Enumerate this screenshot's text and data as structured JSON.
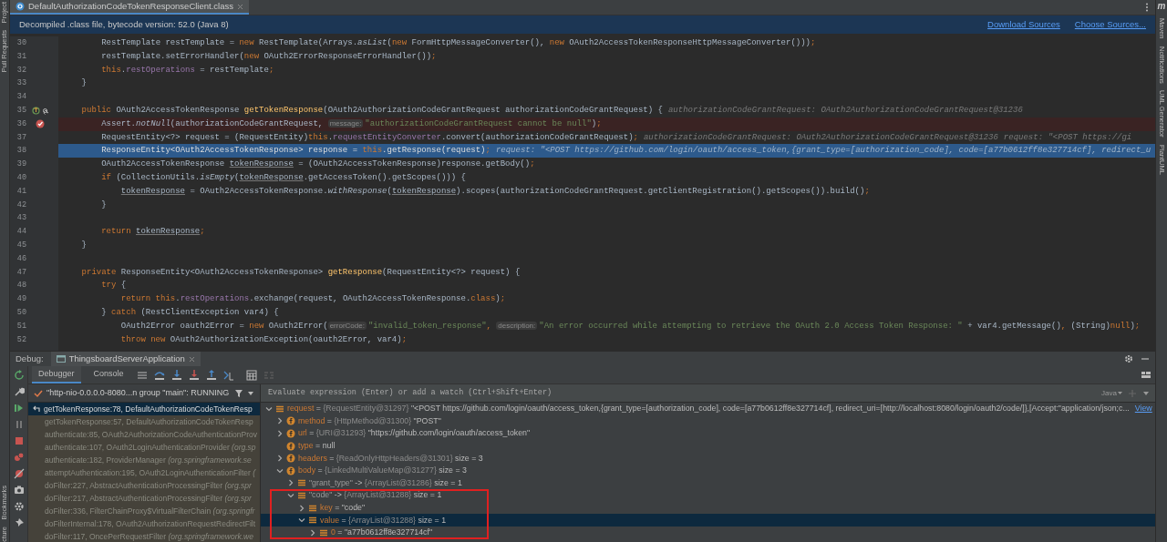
{
  "left_stripe": {
    "labels": [
      "Project",
      "Pull Requests",
      "Bookmarks",
      "cture"
    ]
  },
  "right_stripe": {
    "logo": "m",
    "labels": [
      "Maven",
      "Notifications",
      "UML Generator",
      "PlantUML"
    ]
  },
  "editor_tabs": [
    {
      "label": "DefaultAuthorizationCodeTokenResponseClient.class",
      "selected": true
    }
  ],
  "banner": {
    "text": "Decompiled .class file, bytecode version: 52.0 (Java 8)",
    "links": [
      "Download Sources",
      "Choose Sources..."
    ]
  },
  "code_lines": [
    {
      "number": "30",
      "breakpoint": false,
      "current": false,
      "implements": false,
      "segments": [
        {
          "kind": "p",
          "text": "        RestTemplate restTemplate = "
        },
        {
          "kind": "kw",
          "text": "new "
        },
        {
          "kind": "p",
          "text": "RestTemplate(Arrays."
        },
        {
          "kind": "it",
          "text": "asList"
        },
        {
          "kind": "p",
          "text": "("
        },
        {
          "kind": "kw",
          "text": "new "
        },
        {
          "kind": "p",
          "text": "FormHttpMessageConverter(), "
        },
        {
          "kind": "kw",
          "text": "new "
        },
        {
          "kind": "p",
          "text": "OAuth2AccessTokenResponseHttpMessageConverter()))"
        },
        {
          "kind": "kw",
          "text": ";"
        }
      ]
    },
    {
      "number": "31",
      "breakpoint": false,
      "current": false,
      "implements": false,
      "segments": [
        {
          "kind": "p",
          "text": "        restTemplate.setErrorHandler("
        },
        {
          "kind": "kw",
          "text": "new "
        },
        {
          "kind": "p",
          "text": "OAuth2ErrorResponseErrorHandler())"
        },
        {
          "kind": "kw",
          "text": ";"
        }
      ]
    },
    {
      "number": "32",
      "breakpoint": false,
      "current": false,
      "implements": false,
      "segments": [
        {
          "kind": "kw",
          "text": "        this"
        },
        {
          "kind": "p",
          "text": "."
        },
        {
          "kind": "fld",
          "text": "restOperations"
        },
        {
          "kind": "p",
          "text": " = restTemplate"
        },
        {
          "kind": "kw",
          "text": ";"
        }
      ]
    },
    {
      "number": "33",
      "breakpoint": false,
      "current": false,
      "implements": false,
      "segments": [
        {
          "kind": "p",
          "text": "    }"
        }
      ]
    },
    {
      "number": "34",
      "breakpoint": false,
      "current": false,
      "implements": false
    },
    {
      "number": "35",
      "breakpoint": false,
      "current": false,
      "implements": true,
      "segments": [
        {
          "kind": "kw",
          "text": "    public "
        },
        {
          "kind": "p",
          "text": "OAuth2AccessTokenResponse "
        },
        {
          "kind": "fn",
          "text": "getTokenResponse"
        },
        {
          "kind": "p",
          "text": "(OAuth2AuthorizationCodeGrantRequest authorizationCodeGrantRequest) {"
        },
        {
          "kind": "inlay",
          "text": "authorizationCodeGrantRequest: OAuth2AuthorizationCodeGrantRequest@31236"
        }
      ]
    },
    {
      "number": "36",
      "breakpoint": true,
      "current": false,
      "implements": false,
      "segments": [
        {
          "kind": "p",
          "text": "        Assert."
        },
        {
          "kind": "it",
          "text": "notNull"
        },
        {
          "kind": "p",
          "text": "(authorizationCodeGrantRequest, "
        },
        {
          "kind": "hint",
          "text": "message:"
        },
        {
          "kind": "str",
          "text": "\"authorizationCodeGrantRequest cannot be null\""
        },
        {
          "kind": "p",
          "text": ")"
        },
        {
          "kind": "kw",
          "text": ";"
        }
      ]
    },
    {
      "number": "37",
      "breakpoint": false,
      "current": false,
      "implements": false,
      "segments": [
        {
          "kind": "p",
          "text": "        RequestEntity<?> request = (RequestEntity)"
        },
        {
          "kind": "kw",
          "text": "this"
        },
        {
          "kind": "p",
          "text": "."
        },
        {
          "kind": "fld",
          "text": "requestEntityConverter"
        },
        {
          "kind": "p",
          "text": ".convert(authorizationCodeGrantRequest)"
        },
        {
          "kind": "kw",
          "text": ";"
        },
        {
          "kind": "inlay",
          "text": "authorizationCodeGrantRequest: OAuth2AuthorizationCodeGrantRequest@31236"
        },
        {
          "kind": "inlay",
          "text": "request: \"<POST https://gi"
        }
      ]
    },
    {
      "number": "38",
      "breakpoint": false,
      "current": true,
      "implements": false,
      "segments": [
        {
          "kind": "p",
          "text": "        ResponseEntity<OAuth2AccessTokenResponse> response = "
        },
        {
          "kind": "kw",
          "text": "this"
        },
        {
          "kind": "p",
          "text": ".getResponse(request)"
        },
        {
          "kind": "kw",
          "text": ";"
        },
        {
          "kind": "inlay",
          "text": "request: \"<POST https://github.com/login/oauth/access_token,{grant_type=[authorization_code], code=[a77b0612ff8e327714cf], redirect_u"
        }
      ]
    },
    {
      "number": "39",
      "breakpoint": false,
      "current": false,
      "implements": false,
      "segments": [
        {
          "kind": "p",
          "text": "        OAuth2AccessTokenResponse "
        },
        {
          "kind": "u",
          "text": "tokenResponse"
        },
        {
          "kind": "p",
          "text": " = (OAuth2AccessTokenResponse)response.getBody()"
        },
        {
          "kind": "kw",
          "text": ";"
        }
      ]
    },
    {
      "number": "40",
      "breakpoint": false,
      "current": false,
      "implements": false,
      "segments": [
        {
          "kind": "kw",
          "text": "        if "
        },
        {
          "kind": "p",
          "text": "(CollectionUtils."
        },
        {
          "kind": "it",
          "text": "isEmpty"
        },
        {
          "kind": "p",
          "text": "("
        },
        {
          "kind": "u",
          "text": "tokenResponse"
        },
        {
          "kind": "p",
          "text": ".getAccessToken().getScopes())) {"
        }
      ]
    },
    {
      "number": "41",
      "breakpoint": false,
      "current": false,
      "implements": false,
      "segments": [
        {
          "kind": "u",
          "text": "            tokenResponse"
        },
        {
          "kind": "p",
          "text": " = OAuth2AccessTokenResponse."
        },
        {
          "kind": "it",
          "text": "withResponse"
        },
        {
          "kind": "p",
          "text": "("
        },
        {
          "kind": "u",
          "text": "tokenResponse"
        },
        {
          "kind": "p",
          "text": ").scopes(authorizationCodeGrantRequest.getClientRegistration().getScopes()).build()"
        },
        {
          "kind": "kw",
          "text": ";"
        }
      ]
    },
    {
      "number": "42",
      "breakpoint": false,
      "current": false,
      "implements": false,
      "segments": [
        {
          "kind": "p",
          "text": "        }"
        }
      ]
    },
    {
      "number": "43",
      "breakpoint": false,
      "current": false,
      "implements": false
    },
    {
      "number": "44",
      "breakpoint": false,
      "current": false,
      "implements": false,
      "segments": [
        {
          "kind": "kw",
          "text": "        return "
        },
        {
          "kind": "u",
          "text": "tokenResponse"
        },
        {
          "kind": "kw",
          "text": ";"
        }
      ]
    },
    {
      "number": "45",
      "breakpoint": false,
      "current": false,
      "implements": false,
      "segments": [
        {
          "kind": "p",
          "text": "    }"
        }
      ]
    },
    {
      "number": "46",
      "breakpoint": false,
      "current": false,
      "implements": false
    },
    {
      "number": "47",
      "breakpoint": false,
      "current": false,
      "implements": false,
      "segments": [
        {
          "kind": "kw",
          "text": "    private "
        },
        {
          "kind": "p",
          "text": "ResponseEntity<OAuth2AccessTokenResponse> "
        },
        {
          "kind": "fn",
          "text": "getResponse"
        },
        {
          "kind": "p",
          "text": "(RequestEntity<?> request) {"
        }
      ]
    },
    {
      "number": "48",
      "breakpoint": false,
      "current": false,
      "implements": false,
      "segments": [
        {
          "kind": "kw",
          "text": "        try "
        },
        {
          "kind": "p",
          "text": "{"
        }
      ]
    },
    {
      "number": "49",
      "breakpoint": false,
      "current": false,
      "implements": false,
      "segments": [
        {
          "kind": "kw",
          "text": "            return this"
        },
        {
          "kind": "p",
          "text": "."
        },
        {
          "kind": "fld",
          "text": "restOperations"
        },
        {
          "kind": "p",
          "text": ".exchange(request, OAuth2AccessTokenResponse."
        },
        {
          "kind": "kw",
          "text": "class"
        },
        {
          "kind": "p",
          "text": ")"
        },
        {
          "kind": "kw",
          "text": ";"
        }
      ]
    },
    {
      "number": "50",
      "breakpoint": false,
      "current": false,
      "implements": false,
      "segments": [
        {
          "kind": "p",
          "text": "        } "
        },
        {
          "kind": "kw",
          "text": "catch "
        },
        {
          "kind": "p",
          "text": "(RestClientException var4) {"
        }
      ]
    },
    {
      "number": "51",
      "breakpoint": false,
      "current": false,
      "implements": false,
      "segments": [
        {
          "kind": "p",
          "text": "            OAuth2Error oauth2Error = "
        },
        {
          "kind": "kw",
          "text": "new "
        },
        {
          "kind": "p",
          "text": "OAuth2Error("
        },
        {
          "kind": "hint",
          "text": "errorCode:"
        },
        {
          "kind": "str",
          "text": "\"invalid_token_response\""
        },
        {
          "kind": "kw",
          "text": ", "
        },
        {
          "kind": "hint",
          "text": "description:"
        },
        {
          "kind": "str",
          "text": "\"An error occurred while attempting to retrieve the OAuth 2.0 Access Token Response: \""
        },
        {
          "kind": "p",
          "text": " + var4.getMessage()"
        },
        {
          "kind": "kw",
          "text": ", "
        },
        {
          "kind": "p",
          "text": "(String)"
        },
        {
          "kind": "kw",
          "text": "null"
        },
        {
          "kind": "p",
          "text": ")"
        },
        {
          "kind": "kw",
          "text": ";"
        }
      ]
    },
    {
      "number": "52",
      "breakpoint": false,
      "current": false,
      "implements": false,
      "segments": [
        {
          "kind": "kw",
          "text": "            throw new "
        },
        {
          "kind": "p",
          "text": "OAuth2AuthorizationException(oauth2Error, var4)"
        },
        {
          "kind": "kw",
          "text": ";"
        }
      ]
    }
  ],
  "debug": {
    "label": "Debug:",
    "session_tab": "ThingsboardServerApplication",
    "tabs": [
      {
        "label": "Debugger",
        "selected": true
      },
      {
        "label": "Console",
        "selected": false
      }
    ],
    "thread": "\"http-nio-0.0.0.0-8080...n group \"main\": RUNNING",
    "frames": [
      {
        "text": "getTokenResponse:78, DefaultAuthorizationCodeTokenResp",
        "selected": true
      },
      {
        "text": "getTokenResponse:57, DefaultAuthorizationCodeTokenResp",
        "selected": false
      },
      {
        "text": "authenticate:85, OAuth2AuthorizationCodeAuthenticationProv",
        "selected": false
      },
      {
        "text": "authenticate:107, OAuth2LoginAuthenticationProvider *(org.sp*",
        "selected": false
      },
      {
        "text": "authenticate:182, ProviderManager *(org.springframework.se*",
        "selected": false
      },
      {
        "text": "attemptAuthentication:195, OAuth2LoginAuthenticationFilter *(*",
        "selected": false
      },
      {
        "text": "doFilter:227, AbstractAuthenticationProcessingFilter *(org.spr*",
        "selected": false
      },
      {
        "text": "doFilter:217, AbstractAuthenticationProcessingFilter *(org.spr*",
        "selected": false
      },
      {
        "text": "doFilter:336, FilterChainProxy$VirtualFilterChain *(org.springfr*",
        "selected": false
      },
      {
        "text": "doFilterInternal:178, OAuth2AuthorizationRequestRedirectFilt",
        "selected": false
      },
      {
        "text": "doFilter:117, OncePerRequestFilter *(org.springframework.we*",
        "selected": false
      }
    ],
    "evaluate": {
      "placeholder": "Evaluate expression (Enter) or add a watch (Ctrl+Shift+Enter)",
      "language": "Java"
    },
    "variables": [
      {
        "kind": "local",
        "name": "request",
        "op": "=",
        "ref": "{RequestEntity@31297}",
        "value": "\"<POST https://github.com/login/oauth/access_token,{grant_type=[authorization_code], code=[a77b0612ff8e327714cf], redirect_uri=[http://localhost:8080/login/oauth2/code/]},[Accept:\"application/json;c...",
        "link": "View",
        "expanded": true,
        "selected": false,
        "boxed": false,
        "children": [
          {
            "kind": "field",
            "name": "method",
            "op": "=",
            "ref": "{HttpMethod@31300}",
            "value": "\"POST\"",
            "expanded": false,
            "selected": false,
            "boxed": false
          },
          {
            "kind": "field",
            "name": "url",
            "op": "=",
            "ref": "{URI@31293}",
            "value": "\"https://github.com/login/oauth/access_token\"",
            "expanded": false,
            "selected": false,
            "boxed": false
          },
          {
            "kind": "field",
            "name": "type",
            "op": "=",
            "value": "null",
            "selected": false,
            "boxed": false
          },
          {
            "kind": "field",
            "name": "headers",
            "op": "=",
            "ref": "{ReadOnlyHttpHeaders@31301}",
            "size": "size = 3",
            "expanded": false,
            "selected": false,
            "boxed": false
          },
          {
            "kind": "field",
            "name": "body",
            "op": "=",
            "ref": "{LinkedMultiValueMap@31277}",
            "size": "size = 3",
            "expanded": true,
            "selected": false,
            "boxed": false,
            "children": [
              {
                "kind": "entry",
                "name": "\"grant_type\"",
                "op": "->",
                "ref": "{ArrayList@31286}",
                "size": "size = 1",
                "expanded": false,
                "selected": false,
                "boxed": false
              },
              {
                "kind": "entry",
                "name": "\"code\"",
                "op": "->",
                "ref": "{ArrayList@31288}",
                "size": "size = 1",
                "expanded": true,
                "selected": false,
                "boxed": true,
                "children": [
                  {
                    "kind": "local",
                    "name": "key",
                    "op": "=",
                    "value": "\"code\"",
                    "expanded": false,
                    "selected": false,
                    "boxed": false
                  },
                  {
                    "kind": "local",
                    "name": "value",
                    "op": "=",
                    "ref": "{ArrayList@31288}",
                    "size": "size = 1",
                    "expanded": true,
                    "selected": true,
                    "boxed": false,
                    "children": [
                      {
                        "kind": "local",
                        "name": "0",
                        "op": "=",
                        "value": "\"a77b0612ff8e327714cf\"",
                        "expanded": false,
                        "selected": false,
                        "boxed": false
                      }
                    ]
                  }
                ]
              }
            ]
          }
        ]
      }
    ]
  }
}
